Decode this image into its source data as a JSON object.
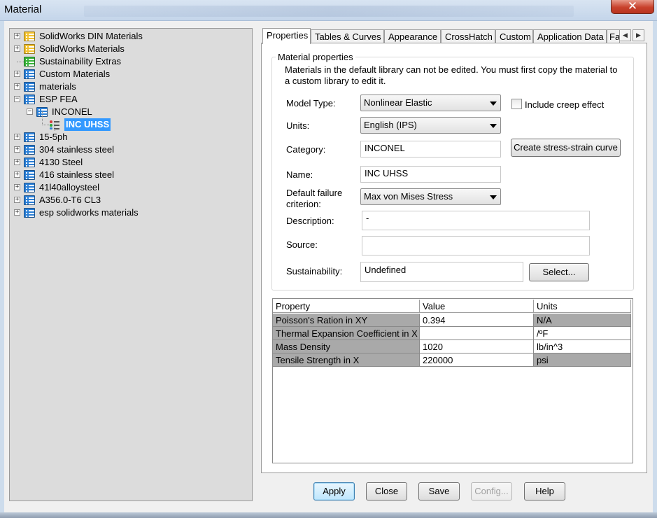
{
  "window": {
    "title": "Material",
    "close_glyph": "✕"
  },
  "tree": {
    "items": [
      {
        "label": "SolidWorks DIN Materials",
        "expander": "+",
        "icon": "library-icon",
        "color": "#f2c12e"
      },
      {
        "label": "SolidWorks Materials",
        "expander": "+",
        "icon": "library-icon",
        "color": "#f2c12e"
      },
      {
        "label": "Sustainability Extras",
        "expander": "",
        "icon": "library-icon",
        "color": "#38b43a"
      },
      {
        "label": "Custom Materials",
        "expander": "+",
        "icon": "library-icon",
        "color": "#2b7fd6"
      },
      {
        "label": "materials",
        "expander": "+",
        "icon": "library-icon",
        "color": "#2b7fd6"
      },
      {
        "label": "ESP FEA",
        "expander": "−",
        "icon": "library-icon",
        "color": "#2b7fd6"
      },
      {
        "label": "INCONEL",
        "expander": "−",
        "icon": "category-icon",
        "color": "#2b7fd6"
      },
      {
        "label": "INC UHSS",
        "expander": "",
        "icon": "material-icon",
        "color": "#d23a3a",
        "selected": true
      },
      {
        "label": "15-5ph",
        "expander": "+",
        "icon": "library-icon",
        "color": "#2b7fd6"
      },
      {
        "label": "304 stainless steel",
        "expander": "+",
        "icon": "library-icon",
        "color": "#2b7fd6"
      },
      {
        "label": "4130 Steel",
        "expander": "+",
        "icon": "library-icon",
        "color": "#2b7fd6"
      },
      {
        "label": "416 stainless steel",
        "expander": "+",
        "icon": "library-icon",
        "color": "#2b7fd6"
      },
      {
        "label": "41l40alloysteel",
        "expander": "+",
        "icon": "library-icon",
        "color": "#2b7fd6"
      },
      {
        "label": "A356.0-T6 CL3",
        "expander": "+",
        "icon": "library-icon",
        "color": "#2b7fd6"
      },
      {
        "label": "esp solidworks materials",
        "expander": "+",
        "icon": "library-icon",
        "color": "#2b7fd6"
      }
    ]
  },
  "tabs": [
    {
      "label": "Properties",
      "active": true
    },
    {
      "label": "Tables & Curves"
    },
    {
      "label": "Appearance"
    },
    {
      "label": "CrossHatch"
    },
    {
      "label": "Custom"
    },
    {
      "label": "Application Data"
    },
    {
      "label": "Favorites"
    }
  ],
  "tab_arrows": {
    "left": "◀",
    "right": "▶"
  },
  "material_properties": {
    "group_title": "Material properties",
    "note": "Materials in the default library can not be edited. You must first copy the material to a custom library to edit it.",
    "model_type_label": "Model Type:",
    "model_type_value": "Nonlinear Elastic",
    "creep_label": "Include creep effect",
    "creep_checked": false,
    "units_label": "Units:",
    "units_value": "English (IPS)",
    "category_label": "Category:",
    "category_value": "INCONEL",
    "stress_strain_button": "Create stress-strain curve",
    "name_label": "Name:",
    "name_value": "INC UHSS",
    "failure_label_line1": "Default failure",
    "failure_label_line2": "criterion:",
    "failure_value": "Max von Mises Stress",
    "description_label": "Description:",
    "description_value": "-",
    "source_label": "Source:",
    "source_value": "",
    "sustainability_label": "Sustainability:",
    "sustainability_value": "Undefined",
    "select_button": "Select..."
  },
  "property_table": {
    "headers": [
      "Property",
      "Value",
      "Units"
    ],
    "rows": [
      [
        "Poisson's Ration in XY",
        "0.394",
        "N/A"
      ],
      [
        "Thermal Expansion Coefficient in X",
        "",
        "/ºF"
      ],
      [
        "Mass Density",
        "1020",
        "lb/in^3"
      ],
      [
        "Tensile Strength in X",
        "220000",
        "psi"
      ]
    ]
  },
  "buttons": {
    "apply": "Apply",
    "close": "Close",
    "save": "Save",
    "config": "Config...",
    "help": "Help"
  }
}
